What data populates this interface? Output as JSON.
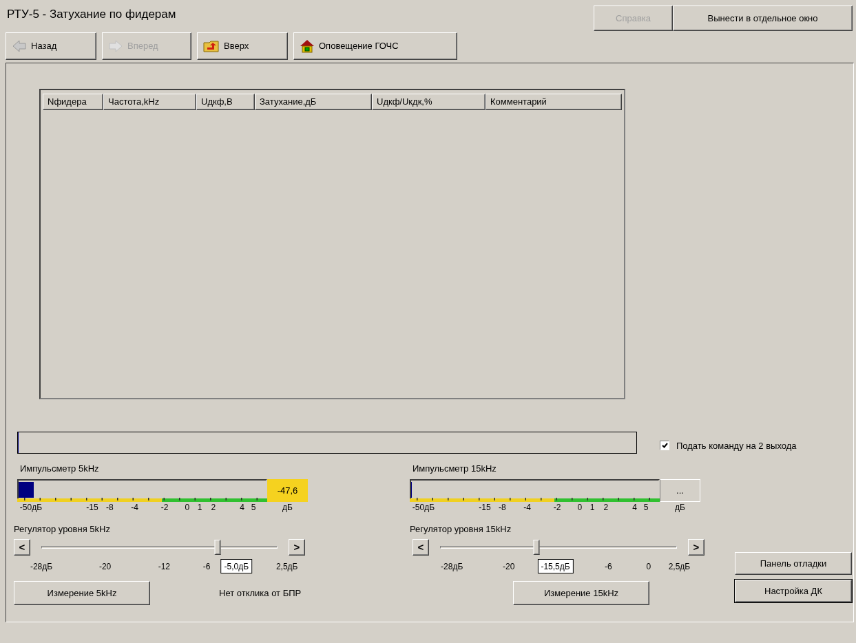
{
  "window": {
    "title": "РТУ-5 - Затухание по фидерам"
  },
  "header_buttons": [
    {
      "label": "Справка",
      "disabled": true
    },
    {
      "label": "Вынести в отдельное окно",
      "disabled": false
    }
  ],
  "toolbar": [
    {
      "label": "Назад",
      "kind": "back",
      "disabled": false
    },
    {
      "label": "Вперед",
      "kind": "forward",
      "disabled": true
    },
    {
      "label": "Вверх",
      "kind": "up",
      "disabled": false
    },
    {
      "label": "Оповещение ГОЧС",
      "kind": "home",
      "disabled": false
    }
  ],
  "table": {
    "columns": [
      "Nфидера",
      "Частота,kHz",
      "Uдкф,В",
      "Затухание,дБ",
      "Uдкф/Uкдк,%",
      "Комментарий"
    ]
  },
  "progress": {
    "level": 0
  },
  "checkbox": {
    "label": "Подать команду на 2 выхода",
    "checked": true
  },
  "channels": [
    {
      "meter": {
        "label": "Импульсметр 5kHz",
        "level": 0.06,
        "reading": "-47,6",
        "alert": true,
        "scale": [
          "-50дБ",
          "-15",
          "-8",
          "-4",
          "-2",
          "0",
          "1",
          "2",
          "4",
          "5"
        ],
        "unit": "дБ"
      },
      "regulator": {
        "label": "Регулятор уровня 5kHz",
        "decrease": "<",
        "increase": ">",
        "level": 0.746,
        "value": "-5,0дБ",
        "ticks": [
          "-28дБ",
          "-20",
          "-12",
          "-6",
          "2,5дБ"
        ]
      },
      "measure_button": "Измерение 5kHz"
    },
    {
      "meter": {
        "label": "Импульсметр 15kHz",
        "level": 0,
        "reading": "...",
        "alert": false,
        "scale": [
          "-50дБ",
          "-15",
          "-8",
          "-4",
          "-2",
          "0",
          "1",
          "2",
          "4",
          "5"
        ],
        "unit": "дБ"
      },
      "regulator": {
        "label": "Регулятор уровня 15kHz",
        "decrease": "<",
        "increase": ">",
        "level": 0.407,
        "value": "-15,5дБ",
        "ticks": [
          "-28дБ",
          "-20",
          "-6",
          "0",
          "2,5дБ"
        ]
      },
      "measure_button": "Измерение 15kHz"
    }
  ],
  "status_text": "Нет отклика от БПР",
  "side_buttons": [
    {
      "label": "Панель отладки",
      "default": false
    },
    {
      "label": "Настройка ДК",
      "default": true
    }
  ]
}
